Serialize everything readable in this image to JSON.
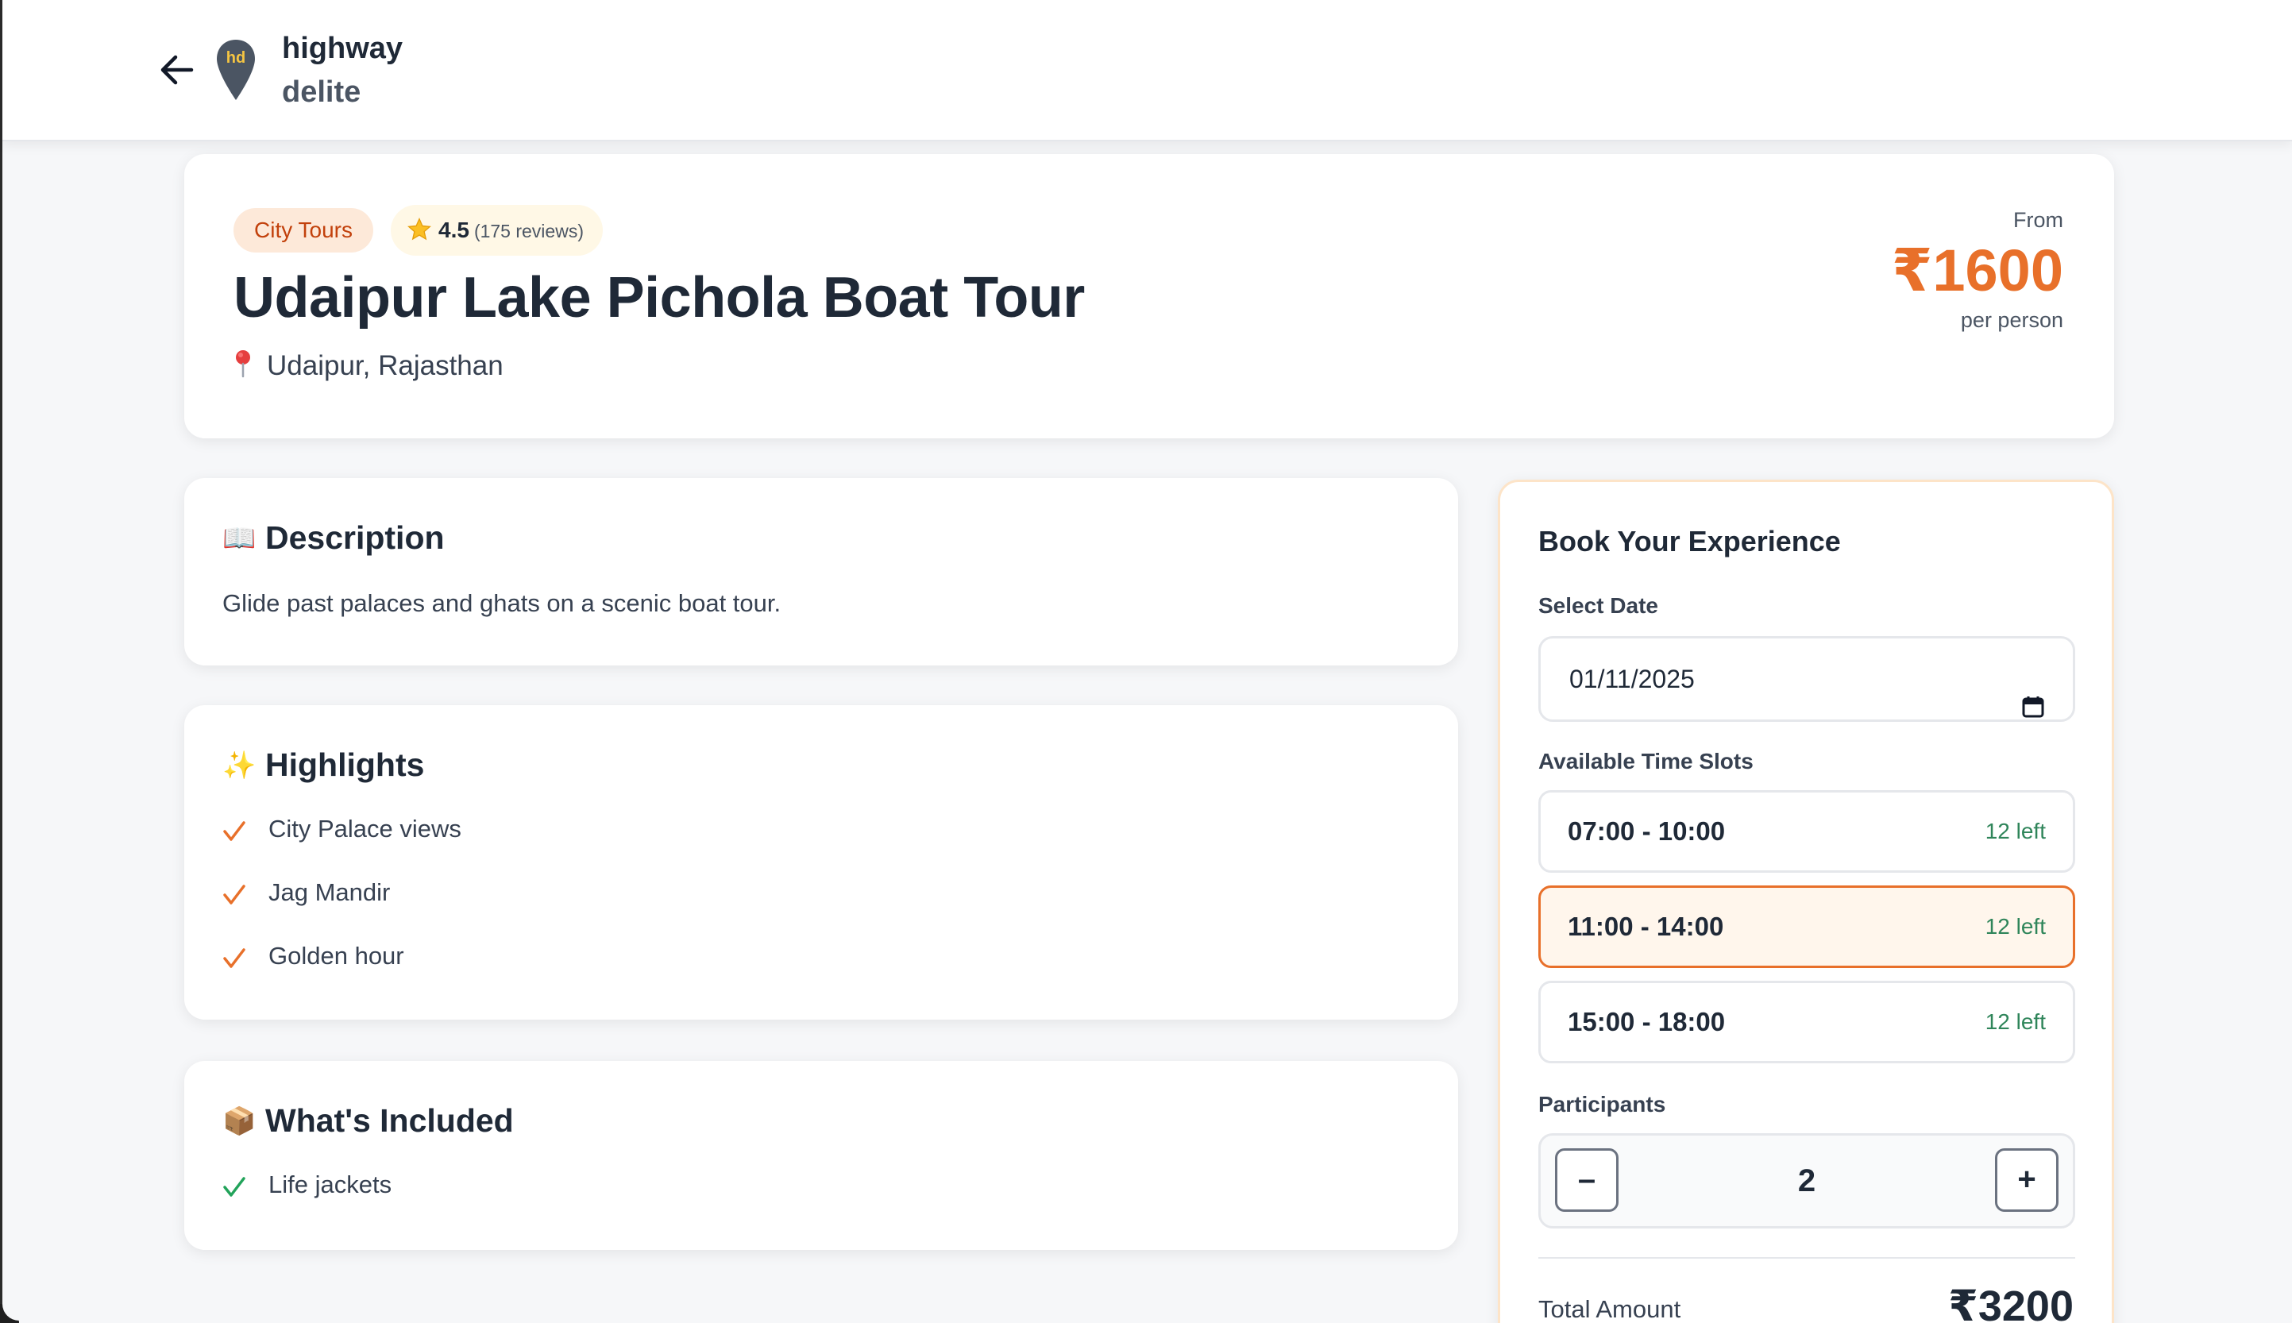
{
  "header": {
    "brand_line1": "highway",
    "brand_line2": "delite",
    "logo_mark": "hd"
  },
  "hero": {
    "category": "City Tours",
    "rating": "4.5",
    "reviews": "(175 reviews)",
    "title": "Udaipur Lake Pichola Boat Tour",
    "location": "Udaipur, Rajasthan",
    "price_from_label": "From",
    "price": "₹1600",
    "price_unit": "per person"
  },
  "description": {
    "icon": "📖",
    "heading": "Description",
    "text": "Glide past palaces and ghats on a scenic boat tour."
  },
  "highlights": {
    "icon": "✨",
    "heading": "Highlights",
    "items": [
      "City Palace views",
      "Jag Mandir",
      "Golden hour"
    ]
  },
  "included": {
    "icon": "📦",
    "heading": "What's Included",
    "items": [
      "Life jackets"
    ]
  },
  "booking": {
    "title": "Book Your Experience",
    "date_label": "Select Date",
    "date_value": "01/11/2025",
    "slots_label": "Available Time Slots",
    "slots": [
      {
        "time": "07:00 - 10:00",
        "left": "12 left",
        "selected": false
      },
      {
        "time": "11:00 - 14:00",
        "left": "12 left",
        "selected": true
      },
      {
        "time": "15:00 - 18:00",
        "left": "12 left",
        "selected": false
      }
    ],
    "participants_label": "Participants",
    "minus": "–",
    "plus": "+",
    "participants": "2",
    "total_label": "Total Amount",
    "total": "₹3200"
  },
  "colors": {
    "accent": "#e8702a",
    "available": "#2f855a",
    "check_highlight": "#e8702a",
    "check_included": "#22a35a"
  }
}
